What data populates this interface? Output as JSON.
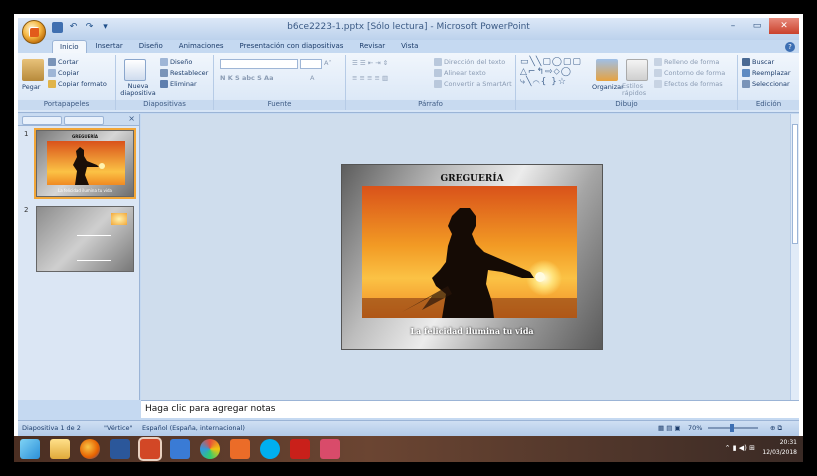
{
  "window": {
    "title": "b6ce2223-1.pptx [Sólo lectura] - Microsoft PowerPoint",
    "controls": [
      "–",
      "▭",
      "✕"
    ]
  },
  "tabs": [
    "Inicio",
    "Insertar",
    "Diseño",
    "Animaciones",
    "Presentación con diapositivas",
    "Revisar",
    "Vista"
  ],
  "ribbon": {
    "portapapeles": {
      "label": "Portapapeles",
      "paste": "Pegar",
      "cut": "Cortar",
      "copy": "Copiar",
      "format_painter": "Copiar formato"
    },
    "diapositivas": {
      "label": "Diapositivas",
      "new_slide": "Nueva diapositiva",
      "layout": "Diseño",
      "reset": "Restablecer",
      "delete": "Eliminar"
    },
    "fuente": {
      "label": "Fuente"
    },
    "parrafo": {
      "label": "Párrafo",
      "text_direction": "Dirección del texto",
      "align_text": "Alinear texto",
      "smartart": "Convertir a SmartArt"
    },
    "dibujo": {
      "label": "Dibujo",
      "arrange": "Organizar",
      "quick_styles": "Estilos rápidos",
      "fill": "Relleno de forma",
      "outline": "Contorno de forma",
      "effects": "Efectos de formas"
    },
    "edicion": {
      "label": "Edición",
      "find": "Buscar",
      "replace": "Reemplazar",
      "select": "Seleccionar"
    }
  },
  "thumbnails": [
    {
      "number": "1",
      "title": "GREGUERÍA",
      "caption": "La felicidad ilumina tu vida"
    },
    {
      "number": "2"
    }
  ],
  "slide": {
    "title": "GREGUERÍA",
    "caption": "La felicidad ilumina tu vida"
  },
  "notes": {
    "placeholder": "Haga clic para agregar notas"
  },
  "status": {
    "slide_count": "Diapositiva 1 de 2",
    "theme": "\"Vértice\"",
    "language": "Español (España, internacional)",
    "zoom": "70%"
  },
  "taskbar": {
    "time": "20:31",
    "date": "12/03/2018"
  }
}
